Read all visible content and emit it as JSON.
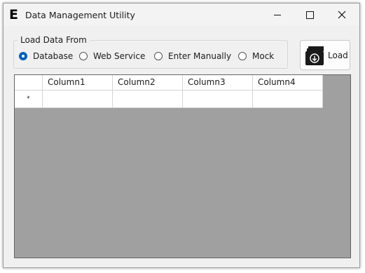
{
  "window": {
    "title": "Data Management Utility",
    "icon": "letter-e-app-icon",
    "controls": [
      "minimize-icon",
      "maximize-icon",
      "close-icon"
    ]
  },
  "load_source": {
    "legend": "Load Data From",
    "options": [
      "Database",
      "Web Service",
      "Enter Manually",
      "Mock"
    ],
    "selected": "Database",
    "accent_color": "#005fb8"
  },
  "load_button": {
    "label": "Load",
    "icon": "folder-download-icon"
  },
  "grid": {
    "columns": [
      "Column1",
      "Column2",
      "Column3",
      "Column4"
    ],
    "new_row_marker": "*",
    "rows": [],
    "empty_area_color": "#a0a0a0"
  }
}
